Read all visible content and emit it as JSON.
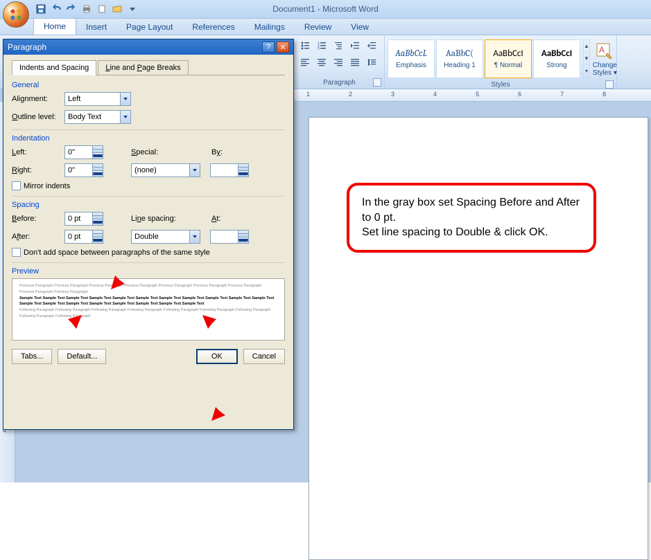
{
  "app": {
    "title": "Document1 - Microsoft Word"
  },
  "qat": {
    "save": "save",
    "undo": "undo",
    "redo": "redo",
    "print": "print",
    "new": "new",
    "open": "open",
    "close": "close"
  },
  "tabs": [
    "Home",
    "Insert",
    "Page Layout",
    "References",
    "Mailings",
    "Review",
    "View"
  ],
  "ribbon": {
    "paragraph_label": "Paragraph",
    "styles_label": "Styles",
    "styles": [
      {
        "preview": "AaBbCcL",
        "label": "Emphasis",
        "cls": "ital"
      },
      {
        "preview": "AaBbC(",
        "label": "Heading 1",
        "cls": ""
      },
      {
        "preview": "AaBbCcI",
        "label": "¶ Normal",
        "cls": "norm",
        "selected": true
      },
      {
        "preview": "AaBbCcI",
        "label": "Strong",
        "cls": "bold"
      }
    ],
    "change_styles": "Change Styles"
  },
  "ruler_h": [
    "1",
    "2",
    "3",
    "4",
    "5",
    "6",
    "7",
    "8"
  ],
  "dialog": {
    "title": "Paragraph",
    "tab1": "Indents and Spacing",
    "tab2": "Line and Page Breaks",
    "general": "General",
    "alignment_label": "Alignment:",
    "alignment_value": "Left",
    "outline_label": "Outline level:",
    "outline_value": "Body Text",
    "indentation": "Indentation",
    "left_label": "Left:",
    "left_value": "0\"",
    "right_label": "Right:",
    "right_value": "0\"",
    "special_label": "Special:",
    "special_value": "(none)",
    "by_label": "By:",
    "by_value": "",
    "mirror": "Mirror indents",
    "spacing": "Spacing",
    "before_label": "Before:",
    "before_value": "0 pt",
    "after_label": "After:",
    "after_value": "0 pt",
    "linespacing_label": "Line spacing:",
    "linespacing_value": "Double",
    "at_label": "At:",
    "at_value": "",
    "nospace": "Don't add space between paragraphs of the same style",
    "preview": "Preview",
    "preview_prev": "Previous Paragraph Previous Paragraph Previous Paragraph Previous Paragraph Previous Paragraph Previous Paragraph Previous Paragraph Previous Paragraph Previous Paragraph",
    "preview_sample": "Sample Text Sample Text Sample Text Sample Text Sample Text Sample Text Sample Text Sample Text Sample Text Sample Text Sample Text Sample Text Sample Text Sample Text Sample Text Sample Text Sample Text Sample Text Sample Text",
    "preview_next": "Following Paragraph Following Paragraph Following Paragraph Following Paragraph Following Paragraph Following Paragraph Following Paragraph Following Paragraph Following Paragraph",
    "tabs_btn": "Tabs...",
    "default_btn": "Default...",
    "ok_btn": "OK",
    "cancel_btn": "Cancel"
  },
  "callout": {
    "line1": "In the gray box set Spacing Before and After to 0 pt.",
    "line2": "Set line spacing to Double & click OK."
  }
}
